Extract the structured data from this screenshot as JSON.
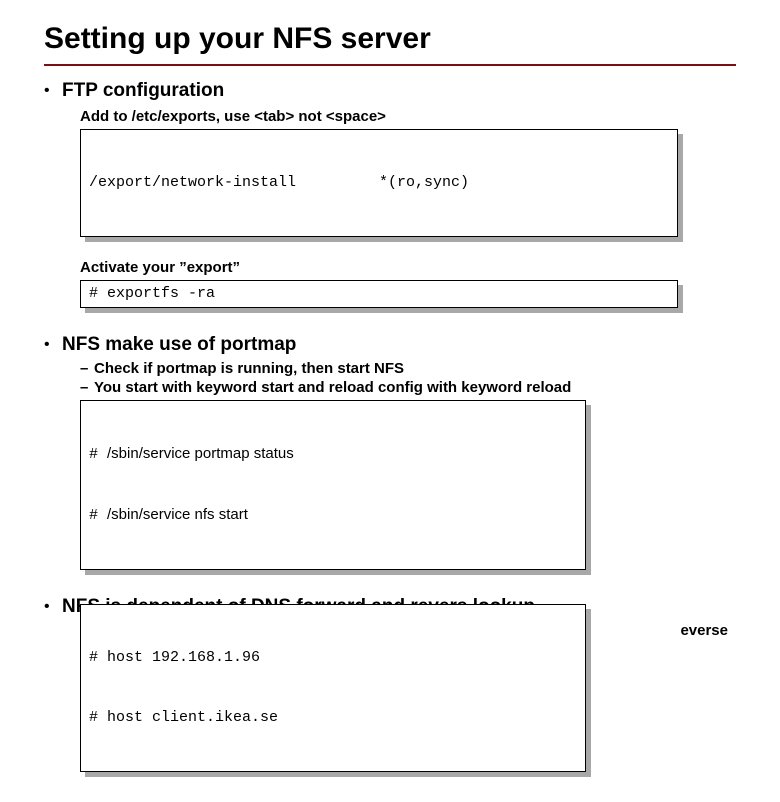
{
  "title": "Setting up your NFS server",
  "section1": {
    "heading": "FTP configuration",
    "sub1": "Add to /etc/exports, use <tab> not <space>",
    "code1_col1": "/export/network-install",
    "code1_col2": "*(ro,sync)",
    "sub2": "Activate your ”export”",
    "code2": "# exportfs -ra"
  },
  "section2": {
    "heading": "NFS make use of portmap",
    "dash1": "Check if portmap is running, then start NFS",
    "dash2": "You start with keyword start and reload config with keyword reload",
    "code_line1": "/sbin/service portmap status",
    "code_line2": "/sbin/service nfs start"
  },
  "section3": {
    "heading": "NFS is dependent of DNS forward and revers lookup",
    "overlap_text": "everse",
    "code_line1": "# host 192.168.1.96",
    "code_line2": "# host client.ikea.se"
  }
}
